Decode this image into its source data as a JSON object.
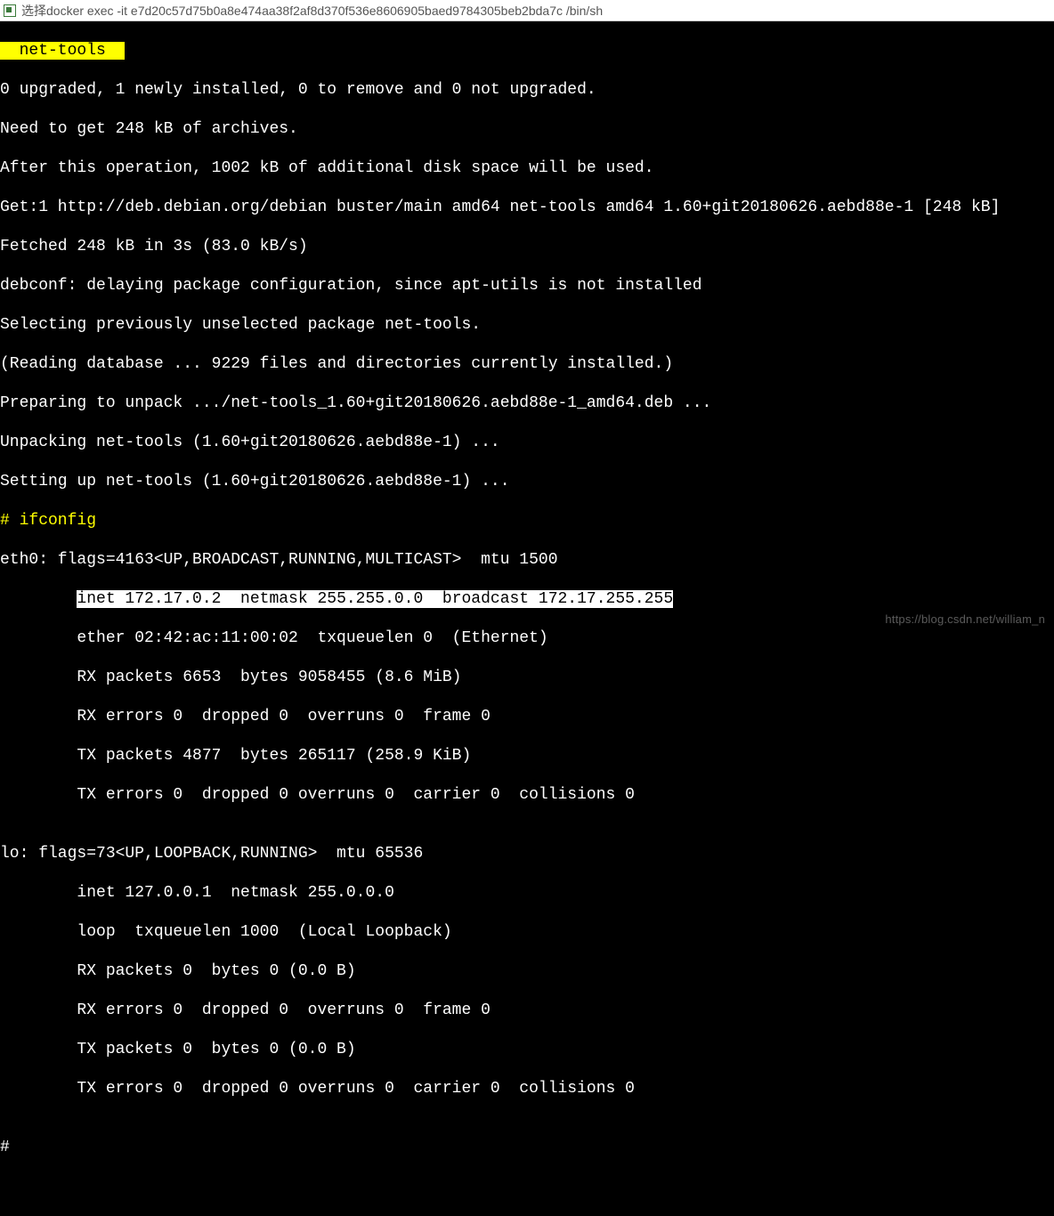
{
  "titlebar": {
    "text": "选择docker  exec -it e7d20c57d75b0a8e474aa38f2af8d370f536e8606905baed9784305beb2bda7c /bin/sh"
  },
  "term": {
    "pkg_name_hl": "  net-tools  ",
    "l1": "0 upgraded, 1 newly installed, 0 to remove and 0 not upgraded.",
    "l2": "Need to get 248 kB of archives.",
    "l3": "After this operation, 1002 kB of additional disk space will be used.",
    "l4": "Get:1 http://deb.debian.org/debian buster/main amd64 net-tools amd64 1.60+git20180626.aebd88e-1 [248 kB]",
    "l5": "Fetched 248 kB in 3s (83.0 kB/s)",
    "l6": "debconf: delaying package configuration, since apt-utils is not installed",
    "l7": "Selecting previously unselected package net-tools.",
    "l8": "(Reading database ... 9229 files and directories currently installed.)",
    "l9": "Preparing to unpack .../net-tools_1.60+git20180626.aebd88e-1_amd64.deb ...",
    "l10": "Unpacking net-tools (1.60+git20180626.aebd88e-1) ...",
    "l11": "Setting up net-tools (1.60+git20180626.aebd88e-1) ...",
    "prompt1": "# ifconfig",
    "eth0_head": "eth0: flags=4163<UP,BROADCAST,RUNNING,MULTICAST>  mtu 1500",
    "eth0_inet_pad": "        ",
    "eth0_inet_hl": "inet 172.17.0.2  netmask 255.255.0.0  broadcast 172.17.255.255",
    "eth0_ether": "        ether 02:42:ac:11:00:02  txqueuelen 0  (Ethernet)",
    "eth0_rxp": "        RX packets 6653  bytes 9058455 (8.6 MiB)",
    "eth0_rxe": "        RX errors 0  dropped 0  overruns 0  frame 0",
    "eth0_txp": "        TX packets 4877  bytes 265117 (258.9 KiB)",
    "eth0_txe": "        TX errors 0  dropped 0 overruns 0  carrier 0  collisions 0",
    "blank": "",
    "lo_head": "lo: flags=73<UP,LOOPBACK,RUNNING>  mtu 65536",
    "lo_inet": "        inet 127.0.0.1  netmask 255.0.0.0",
    "lo_loop": "        loop  txqueuelen 1000  (Local Loopback)",
    "lo_rxp": "        RX packets 0  bytes 0 (0.0 B)",
    "lo_rxe": "        RX errors 0  dropped 0  overruns 0  frame 0",
    "lo_txp": "        TX packets 0  bytes 0 (0.0 B)",
    "lo_txe": "        TX errors 0  dropped 0 overruns 0  carrier 0  collisions 0",
    "prompt2": "# "
  },
  "watermark": "https://blog.csdn.net/william_n"
}
